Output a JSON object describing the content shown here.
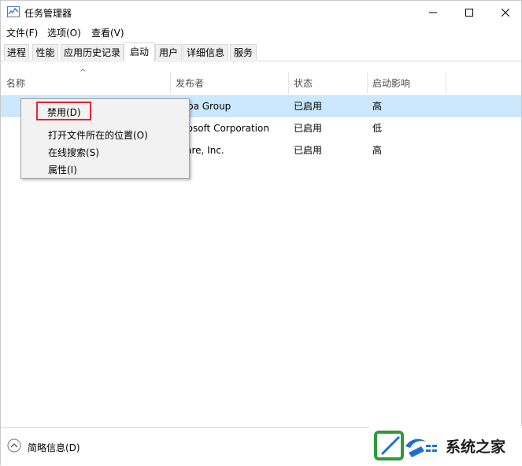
{
  "window": {
    "title": "任务管理器",
    "icons": {
      "app": "task-manager-icon",
      "minimize": "minimize-icon",
      "maximize": "maximize-icon",
      "close": "close-icon"
    }
  },
  "menubar": {
    "file": "文件(F)",
    "options": "选项(O)",
    "view": "查看(V)"
  },
  "tabs": [
    {
      "label": "进程"
    },
    {
      "label": "性能"
    },
    {
      "label": "应用历史记录"
    },
    {
      "label": "启动",
      "active": true
    },
    {
      "label": "用户"
    },
    {
      "label": "详细信息"
    },
    {
      "label": "服务"
    }
  ],
  "table": {
    "columns": {
      "name": "名称",
      "publisher": "发布者",
      "status": "状态",
      "impact": "启动影响"
    },
    "sort_indicator": "^",
    "rows": [
      {
        "publisher": "baba Group",
        "status": "已启用",
        "impact": "高",
        "selected": true
      },
      {
        "publisher": "icrosoft Corporation",
        "status": "已启用",
        "impact": "低"
      },
      {
        "publisher": "lware, Inc.",
        "status": "已启用",
        "impact": "高"
      }
    ]
  },
  "context_menu": {
    "disable": "禁用(D)",
    "open_location": "打开文件所在的位置(O)",
    "search_online": "在线搜索(S)",
    "properties": "属性(I)",
    "highlight_color": "#e0282e"
  },
  "footer": {
    "toggle_label": "简略信息(D)",
    "icon": "chevron-up-circle-icon"
  },
  "watermark": {
    "text": "系统之家",
    "logo": "system-home-logo"
  },
  "colors": {
    "selected_row": "#cce8ff",
    "accent_blue": "#1f6fd1",
    "accent_green": "#2e9a3a"
  }
}
